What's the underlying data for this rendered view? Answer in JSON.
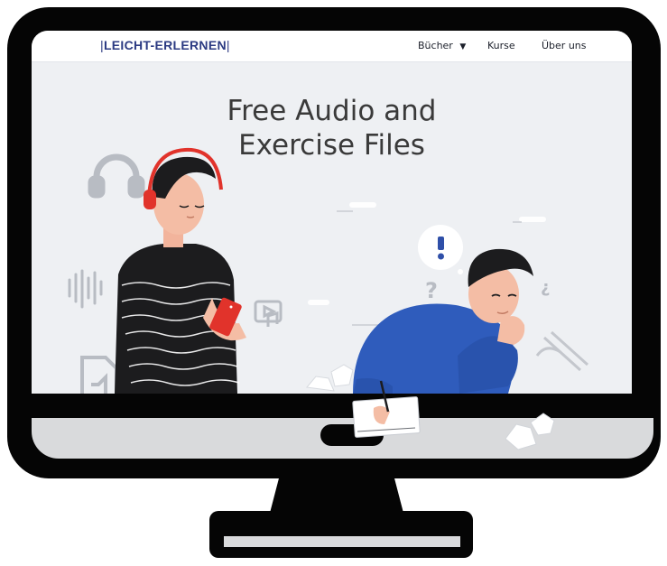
{
  "navbar": {
    "logo": "LEICHT-ERLERNEN",
    "items": [
      "Bücher",
      "Kurse",
      "Über uns"
    ]
  },
  "hero": {
    "title_line1": "Free Audio and",
    "title_line2": "Exercise Files"
  },
  "colors": {
    "brand": "#2b3a82",
    "screen_bg": "#eef0f3",
    "shirt_blue": "#2f5cbc",
    "headphones_red": "#e1332b",
    "bezel": "#050505",
    "chin": "#d9dadc"
  },
  "icons": [
    "headphones-icon",
    "sound-wave-icon",
    "tablet-icon",
    "video-music-icon",
    "audio-file-icon",
    "exclamation-bubble-icon",
    "question-mark-icon",
    "pencil-icon",
    "notepad-icon"
  ]
}
